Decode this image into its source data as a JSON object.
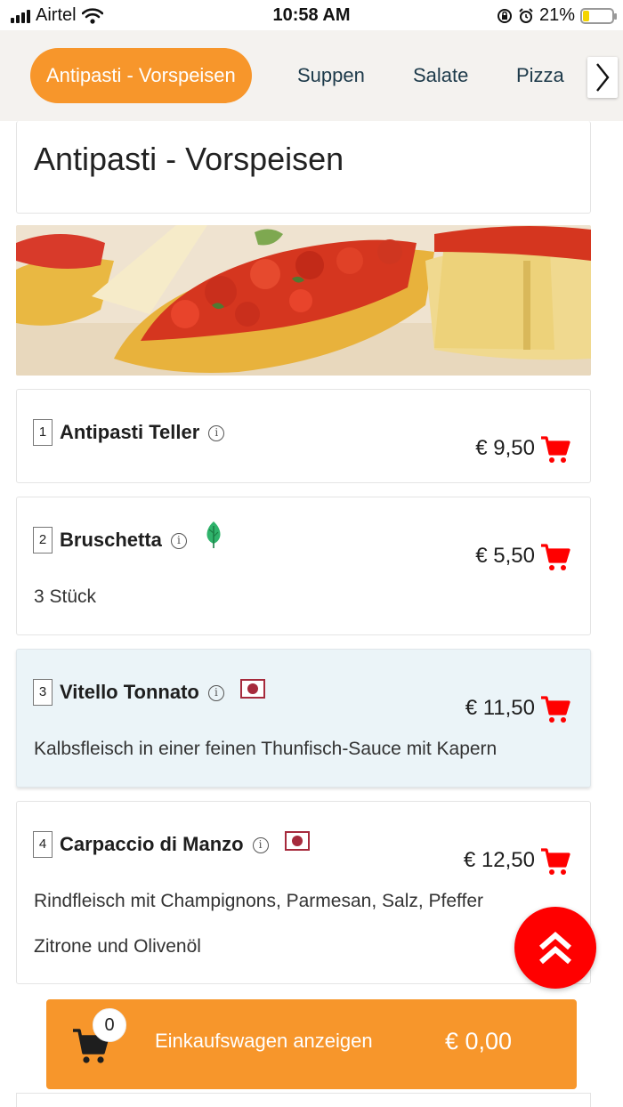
{
  "status_bar": {
    "carrier": "Airtel",
    "time": "10:58 AM",
    "battery": "21%",
    "battery_level": 0.21
  },
  "tabs": [
    {
      "label": "Antipasti - Vorspeisen",
      "active": true
    },
    {
      "label": "Suppen",
      "active": false
    },
    {
      "label": "Salate",
      "active": false
    },
    {
      "label": "Pizza",
      "active": false
    }
  ],
  "section": {
    "title": "Antipasti - Vorspeisen"
  },
  "items": [
    {
      "number": "1",
      "name": "Antipasti Teller",
      "price": "€ 9,50",
      "descriptions": [],
      "badge": ""
    },
    {
      "number": "2",
      "name": "Bruschetta",
      "price": "€ 5,50",
      "descriptions": [
        "3 Stück"
      ],
      "badge": "vegetarian-leaf"
    },
    {
      "number": "3",
      "name": "Vitello Tonnato",
      "price": "€ 11,50",
      "descriptions": [
        "Kalbsfleisch in einer feinen Thunfisch-Sauce mit Kapern"
      ],
      "badge": "meat-dot"
    },
    {
      "number": "4",
      "name": "Carpaccio di Manzo",
      "price": "€ 12,50",
      "descriptions": [
        "Rindfleisch mit Champignons, Parmesan, Salz, Pfeffer",
        "Zitrone und Olivenöl"
      ],
      "badge": "meat-dot"
    }
  ],
  "cart": {
    "count": "0",
    "label": "Einkaufswagen anzeigen",
    "total": "€ 0,00"
  },
  "colors": {
    "accent": "#f7962b",
    "cart_red": "#ff0000",
    "highlight": "#ebf4f8",
    "meat": "#a62a3c",
    "leaf": "#2fb36b"
  }
}
